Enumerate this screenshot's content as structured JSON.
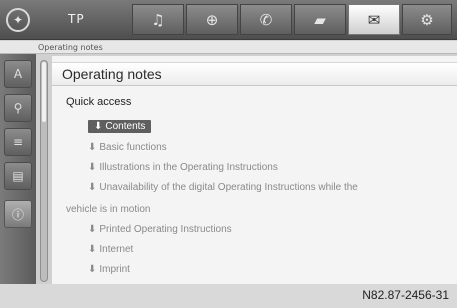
{
  "topbar": {
    "logo_glyph": "✦",
    "mode_label": "TP",
    "tabs": [
      {
        "icon": "music-note-icon",
        "glyph": "♫"
      },
      {
        "icon": "navigation-icon",
        "glyph": "⊕"
      },
      {
        "icon": "phone-icon",
        "glyph": "✆"
      },
      {
        "icon": "car-icon",
        "glyph": "▰"
      },
      {
        "icon": "manual-icon",
        "glyph": "✉"
      },
      {
        "icon": "settings-icon",
        "glyph": "⚙"
      }
    ],
    "active_tab": "manual-icon"
  },
  "breadcrumb": {
    "text": "Operating notes"
  },
  "sidebar": {
    "buttons": [
      {
        "icon": "voice-icon",
        "glyph": "A"
      },
      {
        "icon": "vehicle-search-icon",
        "glyph": "⚲"
      },
      {
        "icon": "doc-search-icon",
        "glyph": "≡"
      },
      {
        "icon": "list-icon",
        "glyph": "▤"
      },
      {
        "icon": "info-icon",
        "glyph": "ⓘ"
      }
    ],
    "active": "info-icon"
  },
  "panel": {
    "title": "Operating notes",
    "quick_access": "Quick access",
    "items": [
      {
        "label": "Contents",
        "selected": true
      },
      {
        "label": "Basic functions",
        "selected": false
      },
      {
        "label": "Illustrations in the Operating Instructions",
        "selected": false
      },
      {
        "label": "Unavailability of the digital Operating Instructions while the",
        "selected": false
      },
      {
        "label": "vehicle is in motion",
        "selected": false
      },
      {
        "label": "Printed Operating Instructions",
        "selected": false
      },
      {
        "label": "Internet",
        "selected": false
      },
      {
        "label": "Imprint",
        "selected": false
      }
    ]
  },
  "reference": "N82.87-2456-31"
}
